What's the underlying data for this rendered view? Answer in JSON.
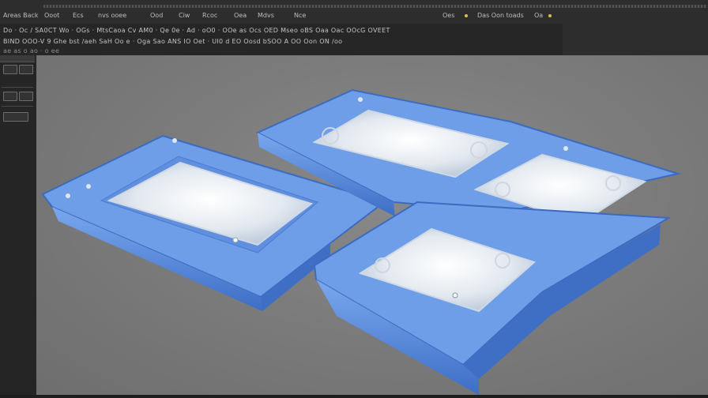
{
  "menubar": {
    "items": [
      "Areas  Back",
      "Ooot",
      "Ecs",
      "nvs ooee",
      "Ood",
      "Ciw",
      "Rcoc",
      "Oea",
      "Mdvs",
      "Nce"
    ],
    "right_items": [
      "Oes",
      "Das Oon toads",
      "Oa"
    ]
  },
  "toolbar": {
    "row1": "Do · Oc / SA0CT Wo  · OGs ·  MtsCaoa Cv  AM0 · Qe 0e · Ad ·  oO0 · OOe as Ocs  OED  Mseo oBS  Oaa Oac  OOcG  OVEET",
    "row2": "BIND  OOO-V 9  Ghe  bst  /aeh  SaH Oo  e  ·  Oga Sao  ANS  IO Oet  ·  UI0  d  EO  Oosd  bSOO  A OO  Oon  ON  /oo",
    "row3": "ae                   as                         o                       ao                  ·                          o      ee"
  },
  "viewport": {
    "object": "blue-plastic-trays-with-frosted-lids",
    "colors": {
      "background": "#7c7c7c",
      "tray": "#5b8fe0",
      "tray_dark": "#3e6fc4",
      "lid": "#eef2f6"
    }
  }
}
